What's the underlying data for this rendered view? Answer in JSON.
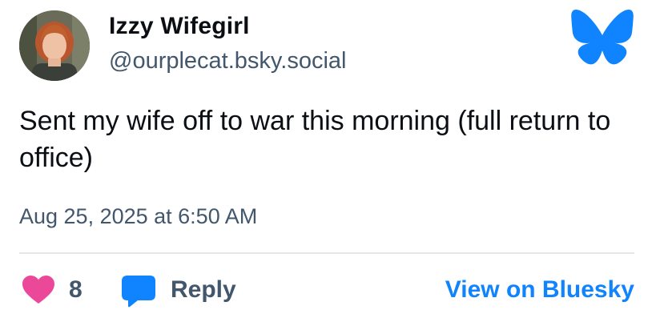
{
  "author": {
    "display_name": "Izzy Wifegirl",
    "handle": "@ourplecat.bsky.social",
    "avatar_icon": "user-avatar-photo"
  },
  "brand": {
    "logo_icon": "bluesky-butterfly-icon",
    "color": "#1083fe"
  },
  "post": {
    "text": "Sent my wife off to war this morning (full return to office)",
    "timestamp": "Aug 25, 2025 at 6:50 AM"
  },
  "actions": {
    "like_icon": "heart-icon",
    "like_color": "#ec4899",
    "like_count": "8",
    "reply_icon": "speech-bubble-icon",
    "reply_label": "Reply",
    "view_label": "View on Bluesky"
  }
}
